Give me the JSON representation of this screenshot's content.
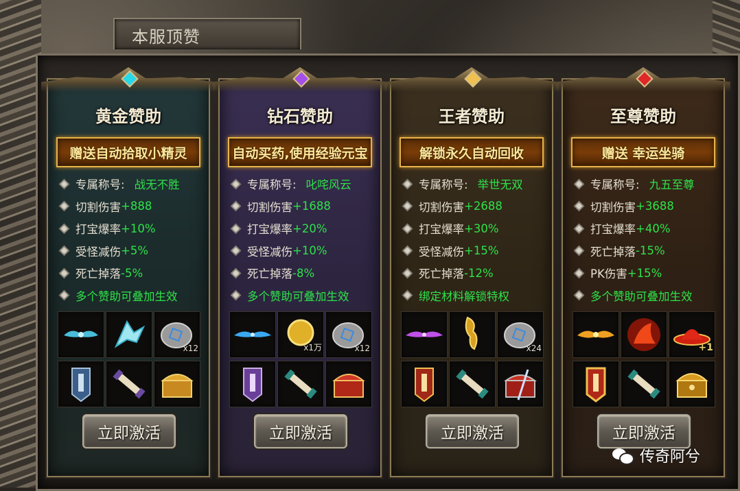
{
  "window": {
    "title": "本服顶赞"
  },
  "cards": [
    {
      "title": "黄金赞助",
      "banner": "赠送自动拾取小精灵",
      "attrs": [
        {
          "label": "专属称号:",
          "value": "战无不胜"
        },
        {
          "label": "切割伤害",
          "value": "+888"
        },
        {
          "label": "打宝爆率",
          "value": "+10%"
        },
        {
          "label": "受怪减伤",
          "value": "+5%"
        },
        {
          "label": "死亡掉落",
          "value": "-5%"
        },
        {
          "label": "",
          "value": "多个赞助可叠加生效"
        }
      ],
      "items": [
        {
          "icon": "cyan-wings-icon",
          "qty": ""
        },
        {
          "icon": "cyan-dragon-pet-icon",
          "qty": ""
        },
        {
          "icon": "rune-stone-icon",
          "qty": "x12"
        },
        {
          "icon": "blue-shield-badge-icon",
          "qty": ""
        },
        {
          "icon": "scroll-icon",
          "qty": ""
        },
        {
          "icon": "gold-chest-icon",
          "qty": ""
        }
      ],
      "button": "立即激活"
    },
    {
      "title": "钻石赞助",
      "banner": "自动买药,使用经验元宝",
      "attrs": [
        {
          "label": "专属称号:",
          "value": "叱咤风云"
        },
        {
          "label": "切割伤害",
          "value": "+1688"
        },
        {
          "label": "打宝爆率",
          "value": "+20%"
        },
        {
          "label": "受怪减伤",
          "value": "+10%"
        },
        {
          "label": "死亡掉落",
          "value": "-8%"
        },
        {
          "label": "",
          "value": "多个赞助可叠加生效"
        }
      ],
      "items": [
        {
          "icon": "blue-wings-icon",
          "qty": ""
        },
        {
          "icon": "gold-coin-icon",
          "qty": "x1万"
        },
        {
          "icon": "rune-stone-icon",
          "qty": "x12"
        },
        {
          "icon": "purple-shield-badge-icon",
          "qty": ""
        },
        {
          "icon": "scroll-icon",
          "qty": ""
        },
        {
          "icon": "red-chest-icon",
          "qty": ""
        }
      ],
      "button": "立即激活"
    },
    {
      "title": "王者赞助",
      "banner": "解锁永久自动回收",
      "attrs": [
        {
          "label": "专属称号:",
          "value": "举世无双"
        },
        {
          "label": "切割伤害",
          "value": "+2688"
        },
        {
          "label": "打宝爆率",
          "value": "+30%"
        },
        {
          "label": "受怪减伤",
          "value": "+15%"
        },
        {
          "label": "死亡掉落",
          "value": "-12%"
        },
        {
          "label": "",
          "value": "绑定材料解锁特权"
        }
      ],
      "items": [
        {
          "icon": "purple-wings-icon",
          "qty": ""
        },
        {
          "icon": "gold-dragon-pet-icon",
          "qty": ""
        },
        {
          "icon": "rune-stone-icon",
          "qty": "x24"
        },
        {
          "icon": "gold-shield-badge-icon",
          "qty": ""
        },
        {
          "icon": "scroll-icon",
          "qty": ""
        },
        {
          "icon": "red-sword-chest-icon",
          "qty": ""
        }
      ],
      "button": "立即激活"
    },
    {
      "title": "至尊赞助",
      "banner": "赠送 幸运坐骑",
      "attrs": [
        {
          "label": "专属称号:",
          "value": "九五至尊"
        },
        {
          "label": "切割伤害",
          "value": "+3688"
        },
        {
          "label": "打宝爆率",
          "value": "+40%"
        },
        {
          "label": "死亡掉落",
          "value": "-15%"
        },
        {
          "label": "PK伤害",
          "value": "+15%"
        },
        {
          "label": "",
          "value": "多个赞助可叠加生效"
        }
      ],
      "items": [
        {
          "icon": "flame-wings-icon",
          "qty": ""
        },
        {
          "icon": "fire-mount-icon",
          "qty": ""
        },
        {
          "icon": "red-hat-icon",
          "qty": "+1"
        },
        {
          "icon": "red-gold-badge-icon",
          "qty": ""
        },
        {
          "icon": "scroll-icon",
          "qty": ""
        },
        {
          "icon": "gold-ornate-chest-icon",
          "qty": ""
        }
      ],
      "button": "立即激活"
    }
  ],
  "watermark": {
    "text": "传奇阿兮",
    "icon": "wechat-icon"
  },
  "colors": {
    "green_value": "#2ee24a",
    "banner_border": "#e5b34a",
    "banner_text": "#ffe79a"
  }
}
